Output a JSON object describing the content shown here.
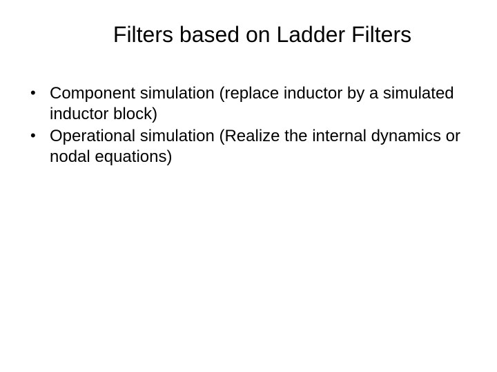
{
  "slide": {
    "title": "Filters based on Ladder Filters",
    "bullets": [
      "Component simulation (replace inductor by a simulated inductor block)",
      "Operational simulation (Realize the internal dynamics or nodal equations)"
    ]
  }
}
